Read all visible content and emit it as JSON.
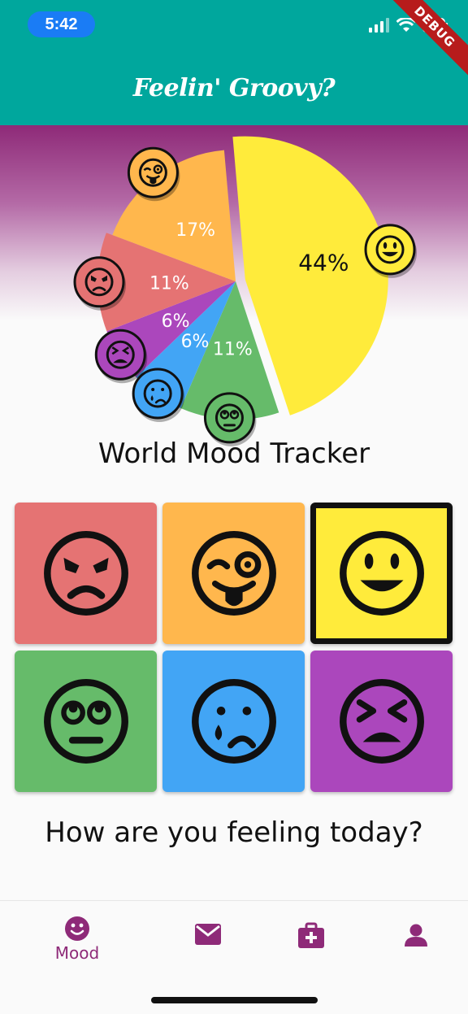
{
  "status": {
    "time": "5:42"
  },
  "debug_banner": "DEBUG",
  "app": {
    "title": "Feelin' Groovy?"
  },
  "chart_data": {
    "type": "pie",
    "title": "",
    "slices": [
      {
        "mood": "happy",
        "value": 44,
        "label": "44%",
        "color": "#ffeb3b"
      },
      {
        "mood": "eyeroll",
        "value": 11,
        "label": "11%",
        "color": "#66bb6a"
      },
      {
        "mood": "sad",
        "value": 6,
        "label": "6%",
        "color": "#42a5f5"
      },
      {
        "mood": "tired",
        "value": 6,
        "label": "6%",
        "color": "#ab47bc"
      },
      {
        "mood": "angry",
        "value": 11,
        "label": "11%",
        "color": "#e57373"
      },
      {
        "mood": "silly",
        "value": 17,
        "label": "17%",
        "color": "#ffb74d"
      }
    ]
  },
  "tracker": {
    "title": "World Mood Tracker"
  },
  "moods": [
    {
      "name": "angry",
      "color": "#e57373",
      "icon": "angry-face-icon",
      "selected": false
    },
    {
      "name": "silly",
      "color": "#ffb74d",
      "icon": "winking-tongue-face-icon",
      "selected": false
    },
    {
      "name": "happy",
      "color": "#ffeb3b",
      "icon": "smiling-face-icon",
      "selected": true
    },
    {
      "name": "eyeroll",
      "color": "#66bb6a",
      "icon": "rolling-eyes-face-icon",
      "selected": false
    },
    {
      "name": "sad",
      "color": "#42a5f5",
      "icon": "crying-face-icon",
      "selected": false
    },
    {
      "name": "tired",
      "color": "#ab47bc",
      "icon": "tired-face-icon",
      "selected": false
    }
  ],
  "prompt": {
    "question": "How are you feeling today?"
  },
  "nav": {
    "items": [
      {
        "label": "Mood",
        "icon": "smile-icon",
        "active": true
      },
      {
        "label": "",
        "icon": "mail-icon",
        "active": false
      },
      {
        "label": "",
        "icon": "medical-kit-icon",
        "active": false
      },
      {
        "label": "",
        "icon": "person-icon",
        "active": false
      }
    ]
  },
  "colors": {
    "teal": "#00a79d",
    "plum": "#8e2a78"
  }
}
